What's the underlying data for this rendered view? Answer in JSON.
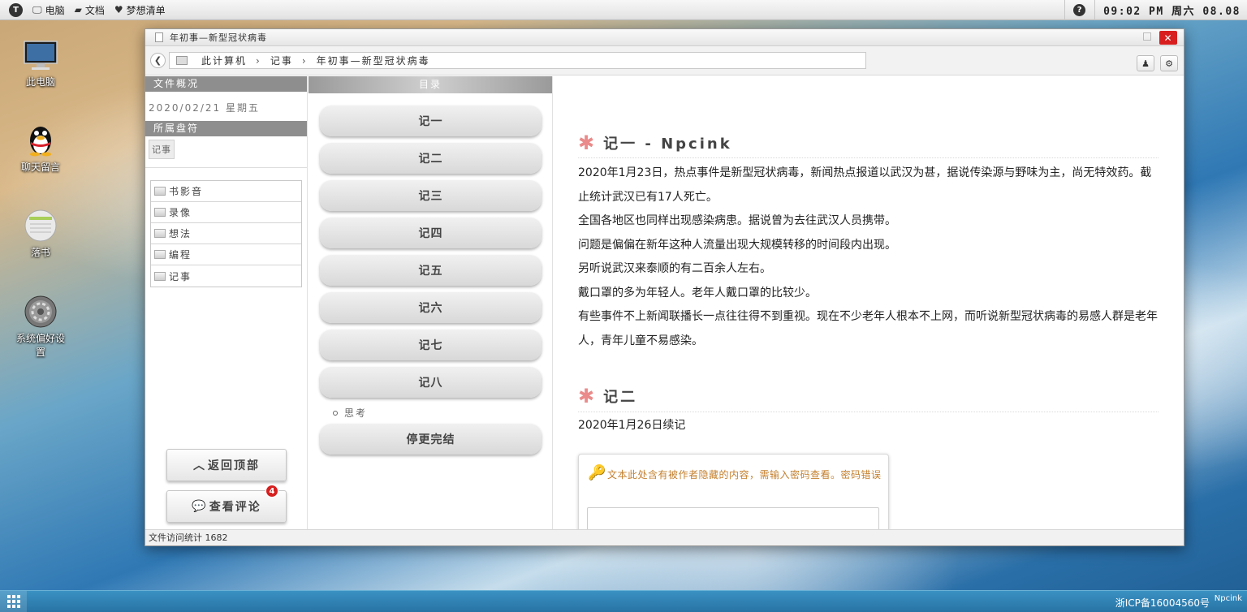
{
  "menubar": {
    "logo": "T",
    "items": [
      {
        "icon": "monitor-icon",
        "label": "电脑"
      },
      {
        "icon": "folder-icon",
        "label": "文档"
      },
      {
        "icon": "heart-icon",
        "label": "梦想清单"
      }
    ],
    "help": "?",
    "clock": "09:02 PM 周六 08.08"
  },
  "desktop": {
    "icons": [
      {
        "icon": "monitor-icon",
        "label": "此电脑"
      },
      {
        "icon": "qq-penguin-icon",
        "label": "聊天留言"
      },
      {
        "icon": "notebook-icon",
        "label": "落书"
      },
      {
        "icon": "settings-gear-icon",
        "label": "系统偏好设置"
      }
    ]
  },
  "window": {
    "title": "年初事—新型冠状病毒",
    "close": "✕",
    "breadcrumb": [
      "此计算机",
      "记事",
      "年初事—新型冠状病毒"
    ]
  },
  "left": {
    "overview_title": "文件概况",
    "date": "2020/02/21 星期五",
    "drive_title": "所属盘符",
    "drive_tag": "记事",
    "folders": [
      "书影音",
      "录像",
      "想法",
      "编程",
      "记事"
    ],
    "back_top": "返回顶部",
    "comments": "查看评论",
    "comment_count": "4"
  },
  "toc": {
    "title": "目录",
    "items": [
      "记一",
      "记二",
      "记三",
      "记四",
      "记五",
      "记六",
      "记七",
      "记八"
    ],
    "sub_item": "思考",
    "last": "停更完结"
  },
  "content": {
    "post1_title": "记一 - Npcink",
    "post1_paras": [
      "2020年1月23日，热点事件是新型冠状病毒，新闻热点报道以武汉为甚，据说传染源与野味为主，尚无特效药。截止统计武汉已有17人死亡。",
      "全国各地区也同样出现感染病患。据说曾为去往武汉人员携带。",
      "问题是偏偏在新年这种人流量出现大规模转移的时间段内出现。",
      "另听说武汉来泰顺的有二百余人左右。",
      "戴口罩的多为年轻人。老年人戴口罩的比较少。",
      "有些事件不上新闻联播长一点往往得不到重视。现在不少老年人根本不上网，而听说新型冠状病毒的易感人群是老年人，青年儿童不易感染。"
    ],
    "post2_title": "记二",
    "post2_para": "2020年1月26日续记",
    "locked_msg": "文本此处含有被作者隐藏的内容，需输入密码查看。密码错误"
  },
  "status": {
    "visits": "文件访问统计 1682"
  },
  "taskbar": {
    "icp": "浙ICP备16004560号",
    "brand": "Npcink"
  },
  "colors": {
    "close_red": "#d81e1e",
    "star_pink": "#ea8a8a",
    "locked_orange": "#c4802e",
    "taskbar_blue": "#2f80b3"
  }
}
